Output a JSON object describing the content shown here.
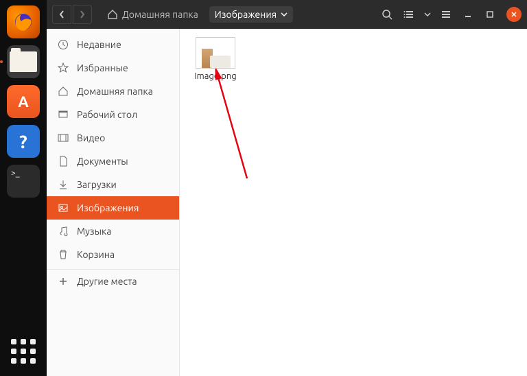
{
  "dock": {
    "help_glyph": "?",
    "term_prompt": ">_",
    "software_glyph": "A"
  },
  "titlebar": {
    "path": {
      "home_label": "Домашняя папка",
      "current_label": "Изображения"
    }
  },
  "sidebar": {
    "items": [
      {
        "label": "Недавние"
      },
      {
        "label": "Избранные"
      },
      {
        "label": "Домашняя папка"
      },
      {
        "label": "Рабочий стол"
      },
      {
        "label": "Видео"
      },
      {
        "label": "Документы"
      },
      {
        "label": "Загрузки"
      },
      {
        "label": "Изображения"
      },
      {
        "label": "Музыка"
      },
      {
        "label": "Корзина"
      }
    ],
    "other_places": "Другие места"
  },
  "content": {
    "files": [
      {
        "name": "Image.png"
      }
    ]
  }
}
